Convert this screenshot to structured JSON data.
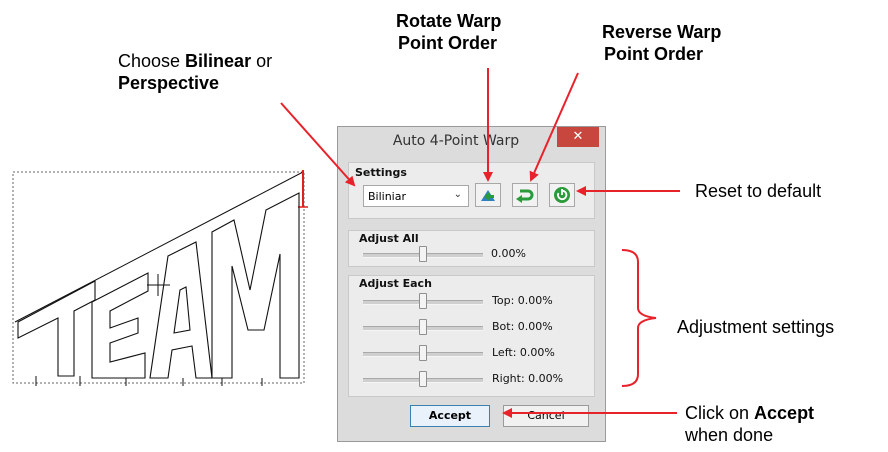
{
  "callouts": {
    "choose": {
      "prefix": "Choose ",
      "bold1": "Bilinear",
      "mid": " or",
      "bold2": "Perspective"
    },
    "rotate": {
      "line1": "Rotate Warp",
      "line2": "Point Order"
    },
    "reverse": {
      "line1": "Reverse Warp",
      "line2": "Point Order"
    },
    "reset": "Reset to default",
    "adjustment": "Adjustment settings",
    "accept": {
      "prefix": "Click on ",
      "bold": "Accept",
      "line2": "when done"
    }
  },
  "canvas": {
    "word": "TEAM"
  },
  "dialog": {
    "title": "Auto 4-Point Warp",
    "close_glyph": "✕",
    "settings": {
      "label": "Settings",
      "mode_value": "Biliniar",
      "caret": "⌄",
      "rotate_icon": "rotate-warp-order-icon",
      "reverse_icon": "reverse-warp-order-icon",
      "reset_icon": "reset-to-default-icon"
    },
    "adjust_all": {
      "label": "Adjust All",
      "value": "0.00%",
      "level": 0.5
    },
    "adjust_each": {
      "label": "Adjust Each",
      "rows": [
        {
          "label": "Top: 0.00%",
          "level": 0.5
        },
        {
          "label": "Bot: 0.00%",
          "level": 0.5
        },
        {
          "label": "Left: 0.00%",
          "level": 0.5
        },
        {
          "label": "Right: 0.00%",
          "level": 0.5
        }
      ]
    },
    "accept_label": "Accept",
    "cancel_label": "Cancel"
  },
  "colors": {
    "arrow": "#e8222a",
    "dialog_bg": "#dcdcdc",
    "close": "#c7463d",
    "icon_green": "#2a9a3a",
    "icon_blue": "#2f7fc6"
  }
}
